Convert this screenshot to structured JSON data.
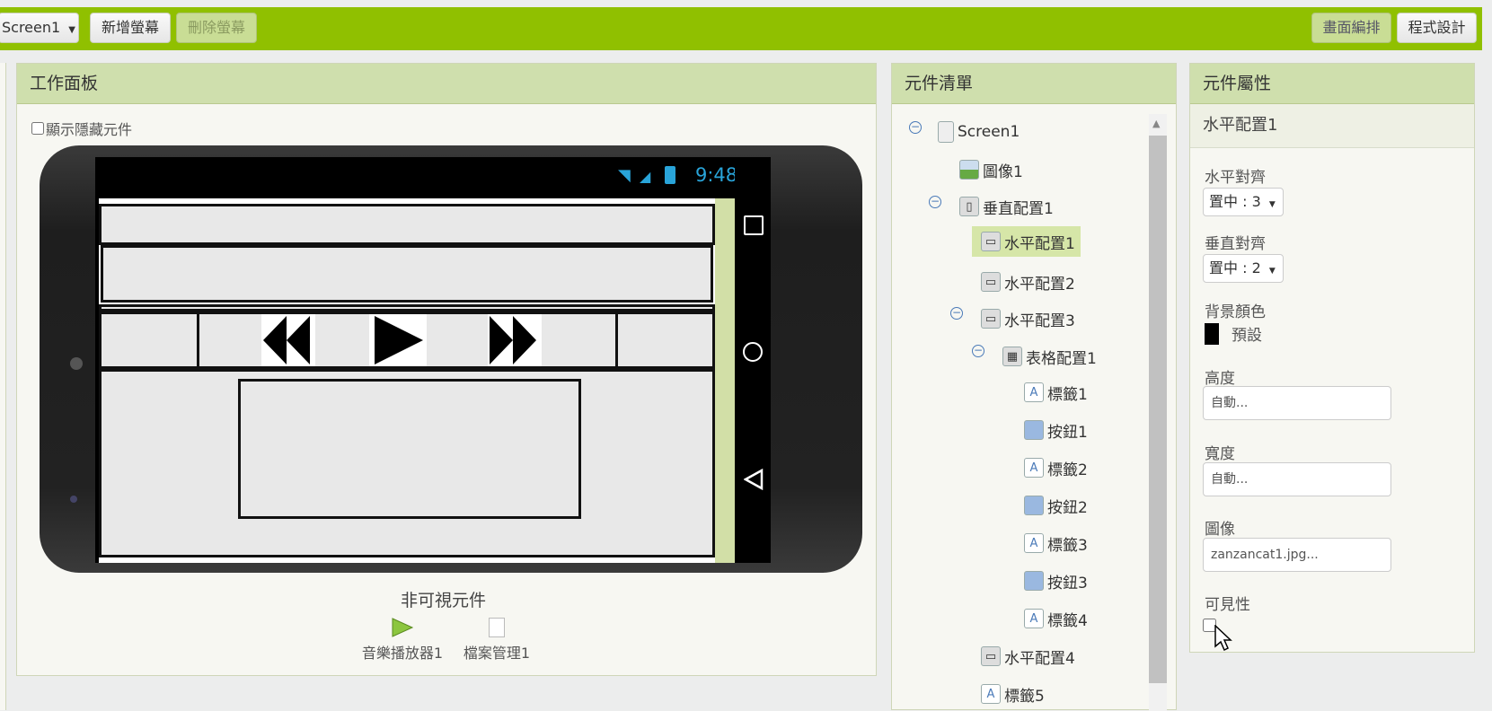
{
  "toolbar": {
    "screen_select": "Screen1",
    "add_screen": "新增螢幕",
    "remove_screen": "刪除螢幕",
    "designer": "畫面編排",
    "blocks": "程式設計"
  },
  "viewer": {
    "title": "工作面板",
    "show_hidden": "顯示隱藏元件",
    "status_time": "9:48",
    "nonvisible_title": "非可視元件",
    "nonvisible": [
      "音樂播放器1",
      "檔案管理1"
    ]
  },
  "components": {
    "title": "元件清單",
    "items": [
      "Screen1",
      "圖像1",
      "垂直配置1",
      "水平配置1",
      "水平配置2",
      "水平配置3",
      "表格配置1",
      "標籤1",
      "按鈕1",
      "標籤2",
      "按鈕2",
      "標籤3",
      "按鈕3",
      "標籤4",
      "水平配置4",
      "標籤5"
    ],
    "selected": "水平配置1"
  },
  "properties": {
    "title": "元件屬性",
    "component_name": "水平配置1",
    "align_h_label": "水平對齊",
    "align_h_value": "置中 : 3",
    "align_v_label": "垂直對齊",
    "align_v_value": "置中 : 2",
    "bg_label": "背景顏色",
    "bg_value": "預設",
    "height_label": "高度",
    "height_value": "自動...",
    "width_label": "寬度",
    "width_value": "自動...",
    "image_label": "圖像",
    "image_value": "zanzancat1.jpg...",
    "visible_label": "可見性"
  },
  "colors": {
    "toolbar_green": "#90c000",
    "panel_header": "#cfdfad",
    "selected_item": "#d6e6a8"
  }
}
